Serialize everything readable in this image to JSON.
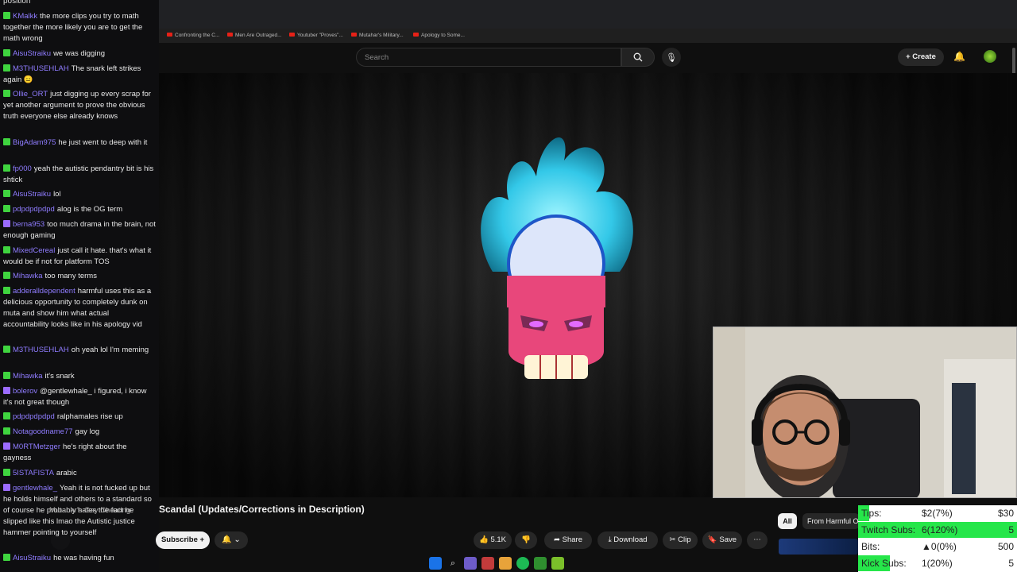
{
  "chat": {
    "top_word": "position",
    "messages": [
      {
        "user": "KMalkk",
        "text": "the more clips you try to math together the more likely you are to get the math wrong",
        "badge": "green",
        "color": "#8f7cff"
      },
      {
        "user": "AisuStraiku",
        "text": "we was digging",
        "badge": "green",
        "color": "#8f7cff"
      },
      {
        "user": "M3THUSEHLAH",
        "text": "The snark left strikes again 😑",
        "badge": "green",
        "color": "#8f7cff"
      },
      {
        "user": "Ollie_ORT",
        "text": "just digging up every scrap for yet another argument to prove the obvious truth everyone else already knows",
        "badge": "green",
        "color": "#8f7cff"
      },
      {
        "user": "BigAdam975",
        "text": "he just went to deep with it",
        "badge": "green",
        "color": "#8f7cff"
      },
      {
        "user": "fp000",
        "text": "yeah the autistic pendantry bit is his shtick",
        "badge": "green",
        "color": "#8f7cff"
      },
      {
        "user": "AisuStraiku",
        "text": "lol",
        "badge": "green",
        "color": "#8f7cff"
      },
      {
        "user": "pdpdpdpdpd",
        "text": "alog is the OG term",
        "badge": "green",
        "color": "#8f7cff"
      },
      {
        "user": "berna953",
        "text": "too much drama in the brain, not enough gaming",
        "badge": "purple",
        "color": "#8f7cff"
      },
      {
        "user": "MixedCereal",
        "text": "just call it hate. that's what it would be if not for platform TOS",
        "badge": "green",
        "color": "#8f7cff"
      },
      {
        "user": "Mihawka",
        "text": "too many terms",
        "badge": "green",
        "color": "#8f7cff"
      },
      {
        "user": "adderalldependent",
        "text": "harmful uses this as a delicious opportunity to completely dunk on muta and show him what actual accountability looks like in his apology vid",
        "badge": "green",
        "color": "#8f7cff"
      },
      {
        "user": "M3THUSEHLAH",
        "text": "oh yeah lol I'm meming",
        "badge": "green",
        "color": "#8f7cff"
      },
      {
        "user": "Mihawka",
        "text": "it's snark",
        "badge": "green",
        "color": "#8f7cff"
      },
      {
        "user": "bolerov",
        "text": "@gentlewhale_ i figured, i know it's not great though",
        "badge": "purple",
        "color": "#8f7cff"
      },
      {
        "user": "pdpdpdpdpd",
        "text": "ralphamales rise up",
        "badge": "green",
        "color": "#8f7cff"
      },
      {
        "user": "Notagoodname77",
        "text": "gay log",
        "badge": "green",
        "color": "#8f7cff"
      },
      {
        "user": "M0RTMetzger",
        "text": "he's right about the gayness",
        "badge": "purple",
        "color": "#8f7cff"
      },
      {
        "user": "5ISTAFISTA",
        "text": "arabic",
        "badge": "green",
        "color": "#8f7cff"
      },
      {
        "user": "gentlewhale_",
        "text": "Yeah it is not fucked up but he holds himself and others to a standard so of course he probably hates the fact he slipped like this lmao the Autistic justice hammer pointing to yourself",
        "badge": "purple",
        "color": "#8f7cff"
      },
      {
        "user": "AisuStraiku",
        "text": "he was having fun",
        "badge": "green",
        "color": "#8f7cff"
      }
    ]
  },
  "browser": {
    "bookmarks": [
      "Confronting the C...",
      "Men Are Outraged...",
      "Youtuber \"Proves\"...",
      "Mutahar's Military...",
      "Apology to Some..."
    ]
  },
  "youtube": {
    "search_placeholder": "Search",
    "create_label": "Create",
    "title": "Scandal (Updates/Corrections in Description)",
    "channel_overlap": "Mutahar's Gay Cheating",
    "subscribe_label": "Subscribe",
    "likes": "5.1K",
    "share_label": "Share",
    "download_label": "Download",
    "clip_label": "Clip",
    "save_label": "Save",
    "chip_all": "All",
    "chip_from": "From Harmful O..."
  },
  "goals": {
    "rows": [
      {
        "label": "Tips:",
        "value": "$2(7%)",
        "target": "$30",
        "fraction": 0.07
      },
      {
        "label": "Twitch Subs:",
        "value": "6(120%)",
        "target": "5",
        "fraction": 1.0
      },
      {
        "label": "Bits:",
        "value": "0(0%)",
        "target": "500",
        "fraction": 0.0
      },
      {
        "label": "Kick Subs:",
        "value": "1(20%)",
        "target": "5",
        "fraction": 0.2
      }
    ],
    "bar_color": "#26e64a"
  }
}
